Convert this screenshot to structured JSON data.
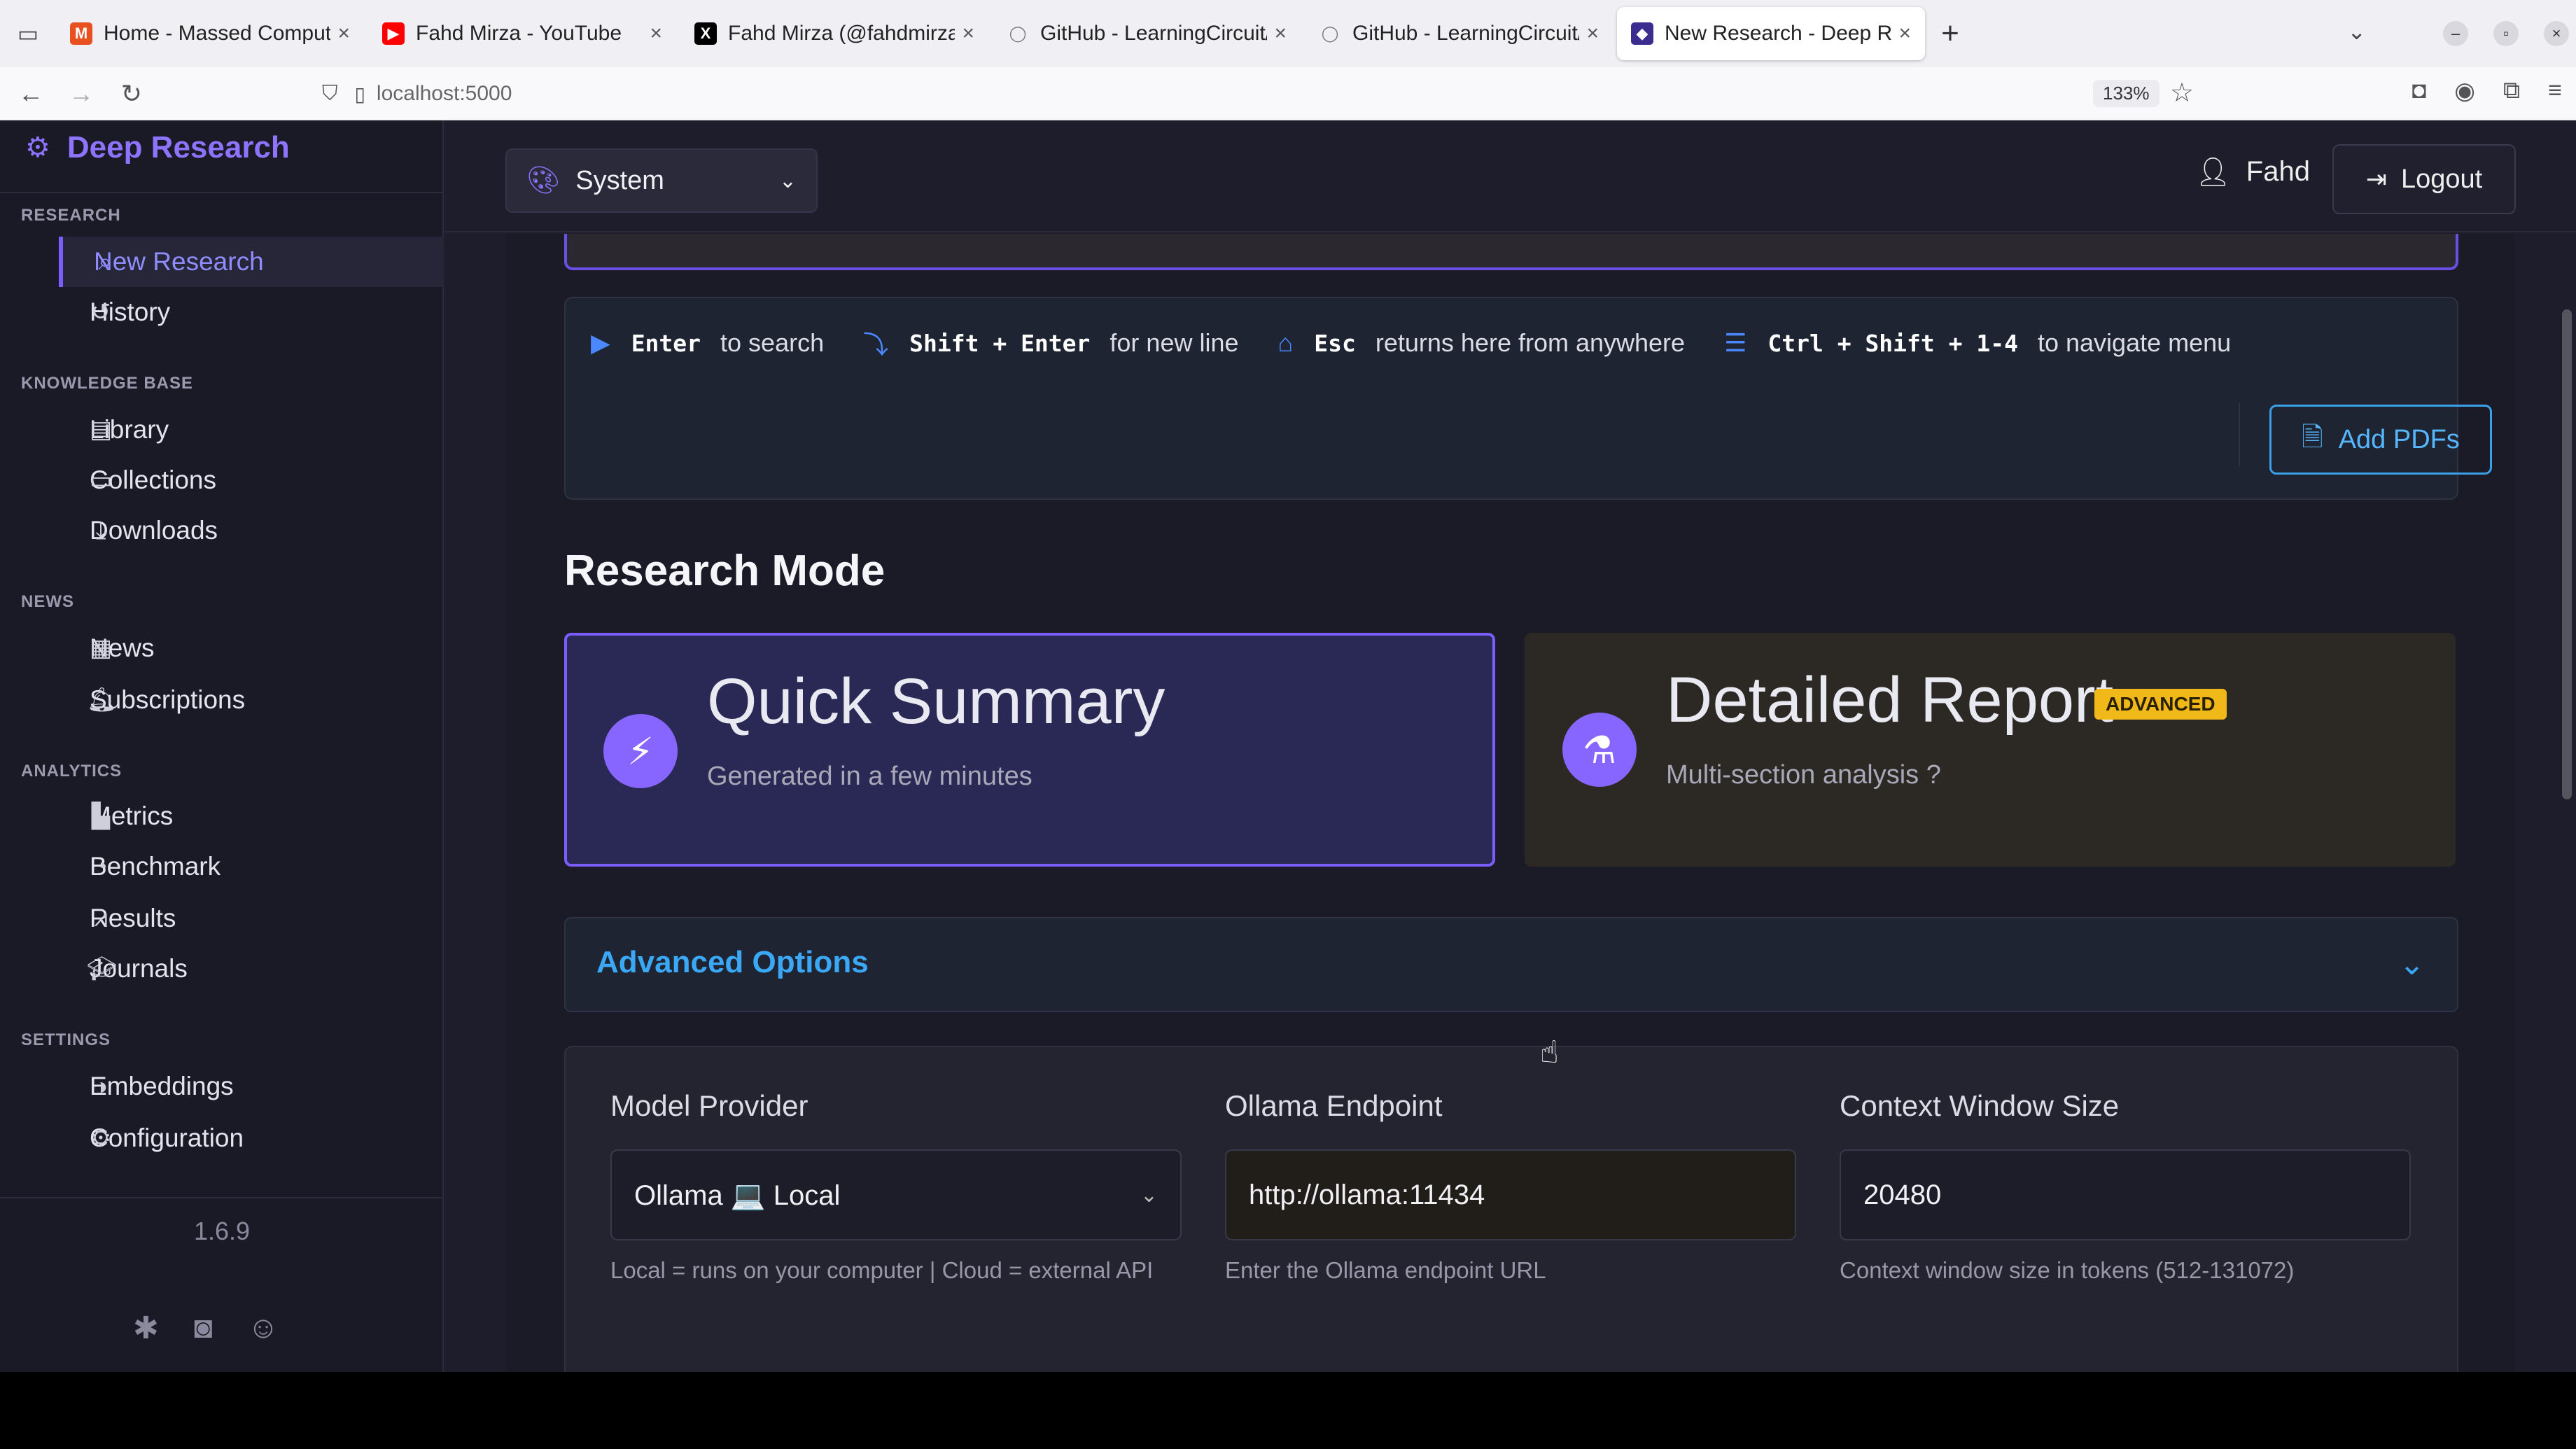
{
  "browser": {
    "tabs": [
      {
        "title": "Home - Massed Compute",
        "favicon": "M",
        "color": "#e8501f"
      },
      {
        "title": "Fahd Mirza - YouTube",
        "favicon": "▶",
        "color": "#ff0000"
      },
      {
        "title": "Fahd Mirza (@fahdmirza)",
        "favicon": "X",
        "color": "#000000"
      },
      {
        "title": "GitHub - LearningCircuit/",
        "favicon": "◯",
        "color": "#777777"
      },
      {
        "title": "GitHub - LearningCircuit/",
        "favicon": "◯",
        "color": "#777777"
      },
      {
        "title": "New Research - Deep Re",
        "favicon": "◆",
        "color": "#3b2c8f"
      }
    ],
    "url": "localhost:5000",
    "zoom": "133%"
  },
  "sidebar": {
    "brand": "Deep Research",
    "sections": {
      "research": "RESEARCH",
      "knowledge": "KNOWLEDGE BASE",
      "news": "NEWS",
      "analytics": "ANALYTICS",
      "settings": "SETTINGS"
    },
    "items": {
      "new_research": "New Research",
      "history": "History",
      "library": "Library",
      "collections": "Collections",
      "downloads": "Downloads",
      "news": "News",
      "subscriptions": "Subscriptions",
      "metrics": "Metrics",
      "benchmark": "Benchmark",
      "results": "Results",
      "journals": "Journals",
      "embeddings": "Embeddings",
      "configuration": "Configuration"
    },
    "version": "1.6.9"
  },
  "header": {
    "theme": "System",
    "user": "Fahd",
    "logout": "Logout"
  },
  "hints": {
    "enter_key": "Enter",
    "enter_text": "to search",
    "shift_key": "Shift + Enter",
    "shift_text": "for new line",
    "esc_key": "Esc",
    "esc_text": "returns here from anywhere",
    "nav_key": "Ctrl + Shift + 1-4",
    "nav_text": "to navigate menu",
    "add_pdfs": "Add PDFs"
  },
  "research_mode": {
    "title": "Research Mode",
    "quick": {
      "name": "Quick Summary",
      "desc": "Generated in a few minutes"
    },
    "detailed": {
      "name": "Detailed Report",
      "badge": "ADVANCED",
      "desc": "Multi-section analysis ?"
    }
  },
  "advanced": {
    "title": "Advanced Options",
    "model_provider": {
      "label": "Model Provider",
      "value": "Ollama 💻 Local",
      "help": "Local = runs on your computer | Cloud = external API"
    },
    "ollama_endpoint": {
      "label": "Ollama Endpoint",
      "value": "http://ollama:11434",
      "help": "Enter the Ollama endpoint URL"
    },
    "context_window": {
      "label": "Context Window Size",
      "value": "20480",
      "help": "Context window size in tokens (512-131072)"
    }
  }
}
